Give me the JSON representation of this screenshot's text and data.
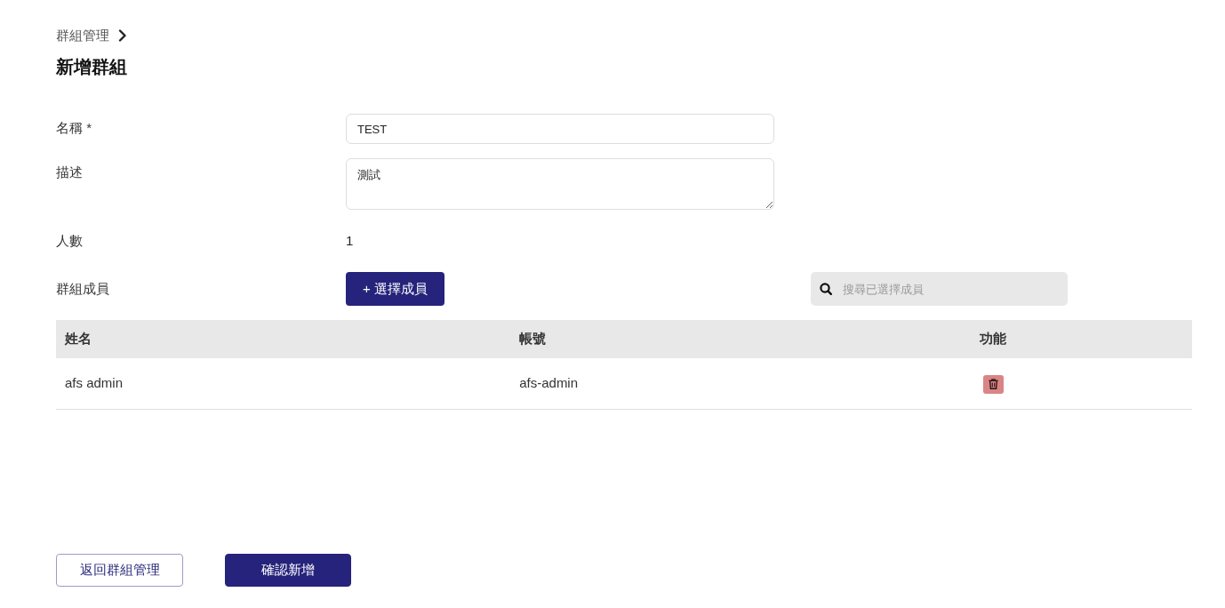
{
  "breadcrumb": {
    "items": [
      {
        "label": "群組管理"
      }
    ]
  },
  "page_title": "新增群組",
  "fields": [
    {
      "kind": "input",
      "label": "名稱 *",
      "value": "TEST"
    },
    {
      "kind": "textarea",
      "label": "描述",
      "value": "測試"
    },
    {
      "kind": "text",
      "label": "人數",
      "value": "1"
    },
    {
      "kind": "members",
      "label": "群組成員",
      "button": "+ 選擇成員",
      "search": {
        "placeholder": "搜尋已選擇成員"
      }
    }
  ],
  "table": {
    "columns": [
      "姓名",
      "帳號",
      "功能"
    ],
    "rows": [
      {
        "cells": [
          "afs admin",
          "afs-admin"
        ]
      }
    ]
  },
  "footer_buttons": [
    {
      "kind": "outline",
      "label": "返回群組管理"
    },
    {
      "kind": "primary",
      "label": "確認新增"
    }
  ]
}
